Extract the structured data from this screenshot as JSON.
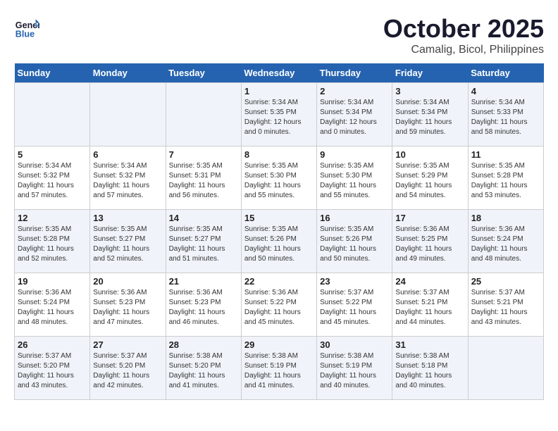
{
  "logo": {
    "line1": "General",
    "line2": "Blue"
  },
  "title": "October 2025",
  "subtitle": "Camalig, Bicol, Philippines",
  "days_of_week": [
    "Sunday",
    "Monday",
    "Tuesday",
    "Wednesday",
    "Thursday",
    "Friday",
    "Saturday"
  ],
  "weeks": [
    [
      {
        "day": "",
        "info": ""
      },
      {
        "day": "",
        "info": ""
      },
      {
        "day": "",
        "info": ""
      },
      {
        "day": "1",
        "info": "Sunrise: 5:34 AM\nSunset: 5:35 PM\nDaylight: 12 hours\nand 0 minutes."
      },
      {
        "day": "2",
        "info": "Sunrise: 5:34 AM\nSunset: 5:34 PM\nDaylight: 12 hours\nand 0 minutes."
      },
      {
        "day": "3",
        "info": "Sunrise: 5:34 AM\nSunset: 5:34 PM\nDaylight: 11 hours\nand 59 minutes."
      },
      {
        "day": "4",
        "info": "Sunrise: 5:34 AM\nSunset: 5:33 PM\nDaylight: 11 hours\nand 58 minutes."
      }
    ],
    [
      {
        "day": "5",
        "info": "Sunrise: 5:34 AM\nSunset: 5:32 PM\nDaylight: 11 hours\nand 57 minutes."
      },
      {
        "day": "6",
        "info": "Sunrise: 5:34 AM\nSunset: 5:32 PM\nDaylight: 11 hours\nand 57 minutes."
      },
      {
        "day": "7",
        "info": "Sunrise: 5:35 AM\nSunset: 5:31 PM\nDaylight: 11 hours\nand 56 minutes."
      },
      {
        "day": "8",
        "info": "Sunrise: 5:35 AM\nSunset: 5:30 PM\nDaylight: 11 hours\nand 55 minutes."
      },
      {
        "day": "9",
        "info": "Sunrise: 5:35 AM\nSunset: 5:30 PM\nDaylight: 11 hours\nand 55 minutes."
      },
      {
        "day": "10",
        "info": "Sunrise: 5:35 AM\nSunset: 5:29 PM\nDaylight: 11 hours\nand 54 minutes."
      },
      {
        "day": "11",
        "info": "Sunrise: 5:35 AM\nSunset: 5:28 PM\nDaylight: 11 hours\nand 53 minutes."
      }
    ],
    [
      {
        "day": "12",
        "info": "Sunrise: 5:35 AM\nSunset: 5:28 PM\nDaylight: 11 hours\nand 52 minutes."
      },
      {
        "day": "13",
        "info": "Sunrise: 5:35 AM\nSunset: 5:27 PM\nDaylight: 11 hours\nand 52 minutes."
      },
      {
        "day": "14",
        "info": "Sunrise: 5:35 AM\nSunset: 5:27 PM\nDaylight: 11 hours\nand 51 minutes."
      },
      {
        "day": "15",
        "info": "Sunrise: 5:35 AM\nSunset: 5:26 PM\nDaylight: 11 hours\nand 50 minutes."
      },
      {
        "day": "16",
        "info": "Sunrise: 5:35 AM\nSunset: 5:26 PM\nDaylight: 11 hours\nand 50 minutes."
      },
      {
        "day": "17",
        "info": "Sunrise: 5:36 AM\nSunset: 5:25 PM\nDaylight: 11 hours\nand 49 minutes."
      },
      {
        "day": "18",
        "info": "Sunrise: 5:36 AM\nSunset: 5:24 PM\nDaylight: 11 hours\nand 48 minutes."
      }
    ],
    [
      {
        "day": "19",
        "info": "Sunrise: 5:36 AM\nSunset: 5:24 PM\nDaylight: 11 hours\nand 48 minutes."
      },
      {
        "day": "20",
        "info": "Sunrise: 5:36 AM\nSunset: 5:23 PM\nDaylight: 11 hours\nand 47 minutes."
      },
      {
        "day": "21",
        "info": "Sunrise: 5:36 AM\nSunset: 5:23 PM\nDaylight: 11 hours\nand 46 minutes."
      },
      {
        "day": "22",
        "info": "Sunrise: 5:36 AM\nSunset: 5:22 PM\nDaylight: 11 hours\nand 45 minutes."
      },
      {
        "day": "23",
        "info": "Sunrise: 5:37 AM\nSunset: 5:22 PM\nDaylight: 11 hours\nand 45 minutes."
      },
      {
        "day": "24",
        "info": "Sunrise: 5:37 AM\nSunset: 5:21 PM\nDaylight: 11 hours\nand 44 minutes."
      },
      {
        "day": "25",
        "info": "Sunrise: 5:37 AM\nSunset: 5:21 PM\nDaylight: 11 hours\nand 43 minutes."
      }
    ],
    [
      {
        "day": "26",
        "info": "Sunrise: 5:37 AM\nSunset: 5:20 PM\nDaylight: 11 hours\nand 43 minutes."
      },
      {
        "day": "27",
        "info": "Sunrise: 5:37 AM\nSunset: 5:20 PM\nDaylight: 11 hours\nand 42 minutes."
      },
      {
        "day": "28",
        "info": "Sunrise: 5:38 AM\nSunset: 5:20 PM\nDaylight: 11 hours\nand 41 minutes."
      },
      {
        "day": "29",
        "info": "Sunrise: 5:38 AM\nSunset: 5:19 PM\nDaylight: 11 hours\nand 41 minutes."
      },
      {
        "day": "30",
        "info": "Sunrise: 5:38 AM\nSunset: 5:19 PM\nDaylight: 11 hours\nand 40 minutes."
      },
      {
        "day": "31",
        "info": "Sunrise: 5:38 AM\nSunset: 5:18 PM\nDaylight: 11 hours\nand 40 minutes."
      },
      {
        "day": "",
        "info": ""
      }
    ]
  ]
}
